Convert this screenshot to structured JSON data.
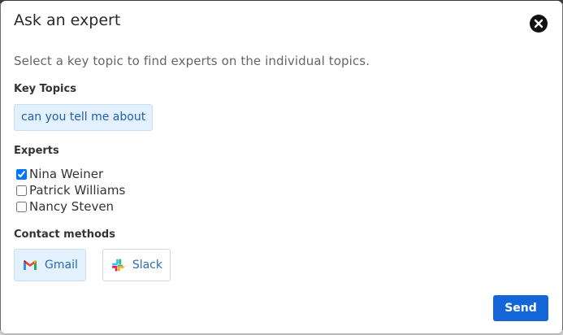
{
  "dialog": {
    "title": "Ask an expert",
    "intro": "Select a key topic to find experts on the individual topics."
  },
  "key_topics": {
    "label": "Key Topics",
    "chips": [
      {
        "label": "can you tell me about",
        "selected": true
      }
    ]
  },
  "experts": {
    "label": "Experts",
    "items": [
      {
        "name": "Nina Weiner",
        "checked": true
      },
      {
        "name": "Patrick Williams",
        "checked": false
      },
      {
        "name": "Nancy Steven",
        "checked": false
      }
    ]
  },
  "contact_methods": {
    "label": "Contact methods",
    "options": [
      {
        "label": "Gmail",
        "icon": "gmail-icon",
        "selected": true
      },
      {
        "label": "Slack",
        "icon": "slack-icon",
        "selected": false
      }
    ]
  },
  "actions": {
    "send_label": "Send"
  },
  "colors": {
    "accent": "#1466d8",
    "chip_bg": "#e3f0fd",
    "chip_text": "#1f5fae"
  }
}
